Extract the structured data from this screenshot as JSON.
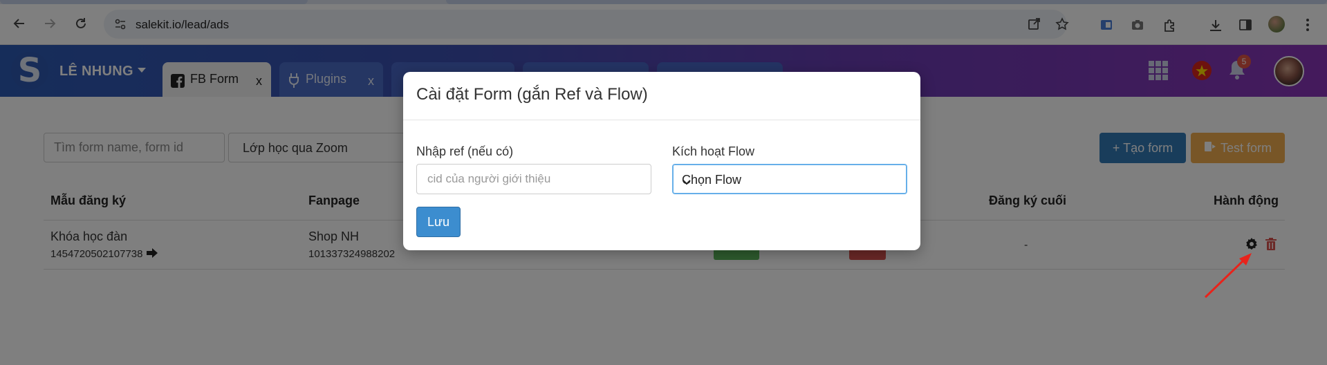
{
  "browser": {
    "url": "salekit.io/lead/ads"
  },
  "header": {
    "user_name": "LÊ NHUNG",
    "tabs": [
      {
        "label": "FB Form",
        "close": "x"
      },
      {
        "label": "Plugins",
        "close": "x"
      }
    ],
    "notification_count": "5"
  },
  "toolbar": {
    "search_placeholder": "Tìm form name, form id",
    "filter_value": "Lớp học qua Zoom",
    "create_label": "+ Tạo form",
    "test_label": "Test form"
  },
  "table": {
    "columns": [
      "Mẫu đăng ký",
      "Fanpage",
      "Đăng ký cuối",
      "Hành động"
    ],
    "rows": [
      {
        "form_name": "Khóa học đàn",
        "form_id": "1454720502107738",
        "fanpage": "Shop NH",
        "fanpage_id": "101337324988202",
        "last_registered": "-"
      }
    ]
  },
  "modal": {
    "title": "Cài đặt Form (gắn Ref và Flow)",
    "ref_label": "Nhập ref (nếu có)",
    "ref_placeholder": "cid của người giới thiệu",
    "flow_label": "Kích hoạt Flow",
    "flow_value": "Chọn Flow",
    "save_label": "Lưu"
  },
  "colors": {
    "primary": "#337ab7",
    "warning": "#f0ad4e",
    "success": "#5cb85c",
    "danger": "#d9534f",
    "header_start": "#2d5bb5",
    "header_end": "#8a35b9"
  }
}
